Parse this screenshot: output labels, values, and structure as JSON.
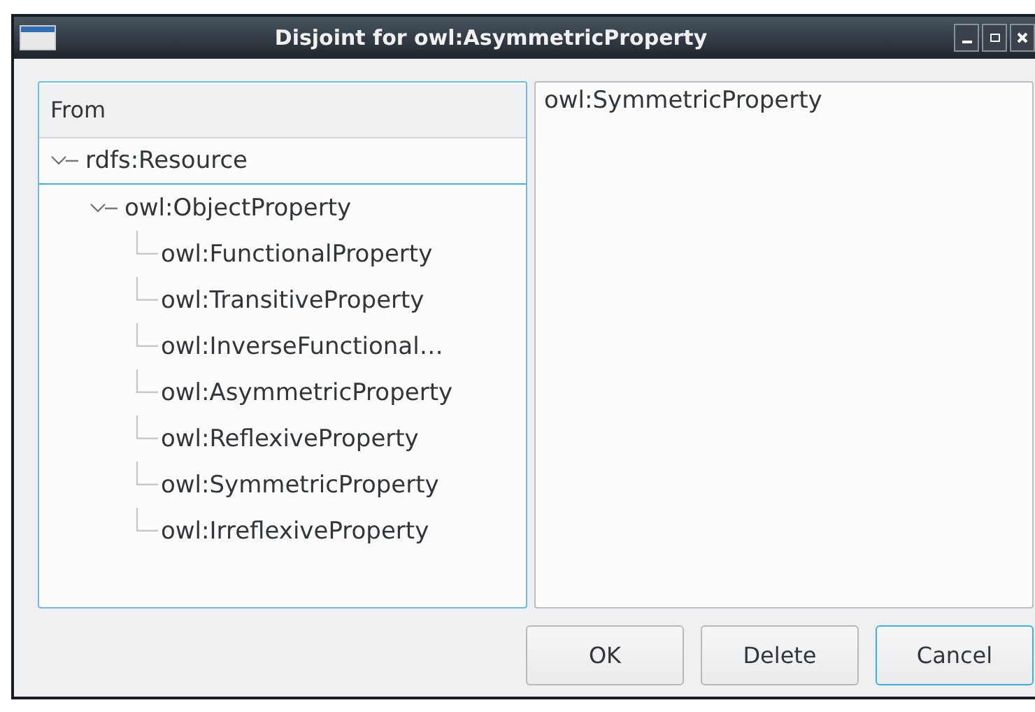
{
  "window": {
    "title": "Disjoint for owl:AsymmetricProperty"
  },
  "tree": {
    "header": "From",
    "nodes": [
      {
        "label": "rdfs:Resource",
        "expanded": true,
        "selected": true,
        "children": [
          {
            "label": "owl:ObjectProperty",
            "expanded": true,
            "selected": false,
            "children": [
              {
                "label": "owl:FunctionalProperty",
                "selected": false
              },
              {
                "label": "owl:TransitiveProperty",
                "selected": false
              },
              {
                "label": "owl:InverseFunctional…",
                "selected": false
              },
              {
                "label": "owl:AsymmetricProperty",
                "selected": false
              },
              {
                "label": "owl:ReflexiveProperty",
                "selected": false
              },
              {
                "label": "owl:SymmetricProperty",
                "selected": false
              },
              {
                "label": "owl:IrreflexiveProperty",
                "selected": false
              }
            ]
          }
        ]
      }
    ]
  },
  "list": {
    "items": [
      {
        "label": "owl:SymmetricProperty"
      }
    ]
  },
  "buttons": [
    {
      "label": "OK",
      "focused": false
    },
    {
      "label": "Delete",
      "focused": false
    },
    {
      "label": "Cancel",
      "focused": true
    }
  ]
}
